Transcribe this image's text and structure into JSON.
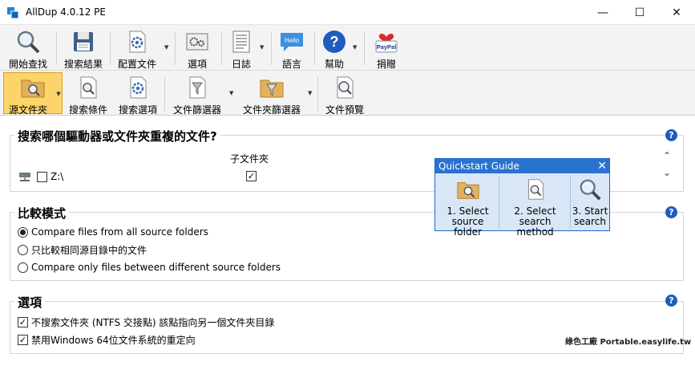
{
  "window": {
    "title": "AllDup 4.0.12 PE",
    "minimize": "—",
    "maximize": "☐",
    "close": "✕"
  },
  "toolbar_main": [
    {
      "label": "開始查找",
      "icon": "magnifier-icon"
    },
    {
      "label": "搜索結果",
      "icon": "save-disk-icon"
    },
    {
      "label": "配置文件",
      "icon": "config-file-icon"
    },
    {
      "label": "選項",
      "icon": "options-icon"
    },
    {
      "label": "日誌",
      "icon": "log-icon"
    },
    {
      "label": "語言",
      "icon": "hello-bubble-icon",
      "icon_text": "Hello"
    },
    {
      "label": "幫助",
      "icon": "help-icon",
      "icon_text": "?"
    },
    {
      "label": "捐贈",
      "icon": "paypal-heart-icon",
      "icon_text": "PayPal"
    }
  ],
  "toolbar_tabs": [
    {
      "label": "源文件夾",
      "selected": true
    },
    {
      "label": "搜索條件"
    },
    {
      "label": "搜索選項"
    },
    {
      "label": "文件篩選器"
    },
    {
      "label": "文件夾篩選器"
    },
    {
      "label": "文件預覽"
    }
  ],
  "source_panel": {
    "title": "搜索哪個驅動器或文件夾重複的文件?",
    "column_subfolders": "子文件夾",
    "drive_label": "Z:\\",
    "drive_checked": false,
    "subfolders_checked": true
  },
  "compare_panel": {
    "title": "比較模式",
    "options": [
      {
        "label": "Compare files from all source folders",
        "selected": true
      },
      {
        "label": "只比較相同源目錄中的文件",
        "selected": false
      },
      {
        "label": "Compare only files between different source folders",
        "selected": false
      }
    ]
  },
  "options_panel": {
    "title": "選項",
    "checks": [
      {
        "label": "不搜索文件夾 (NTFS 交接點) 該點指向另一個文件夾目錄",
        "checked": true
      },
      {
        "label": "禁用Windows 64位文件系統的重定向",
        "checked": true
      }
    ]
  },
  "quickstart": {
    "title": "Quickstart Guide",
    "steps": [
      {
        "line1": "1. Select",
        "line2": "source folder"
      },
      {
        "line1": "2. Select",
        "line2": "search method"
      },
      {
        "line1": "3. Start",
        "line2": "search"
      }
    ]
  },
  "watermark": "綠色工廠 Portable.easylife.tw",
  "help_glyph": "?",
  "check_glyph": "✓",
  "scroll_up": "⌃",
  "scroll_down": "⌄",
  "dropdown_glyph": "▼"
}
